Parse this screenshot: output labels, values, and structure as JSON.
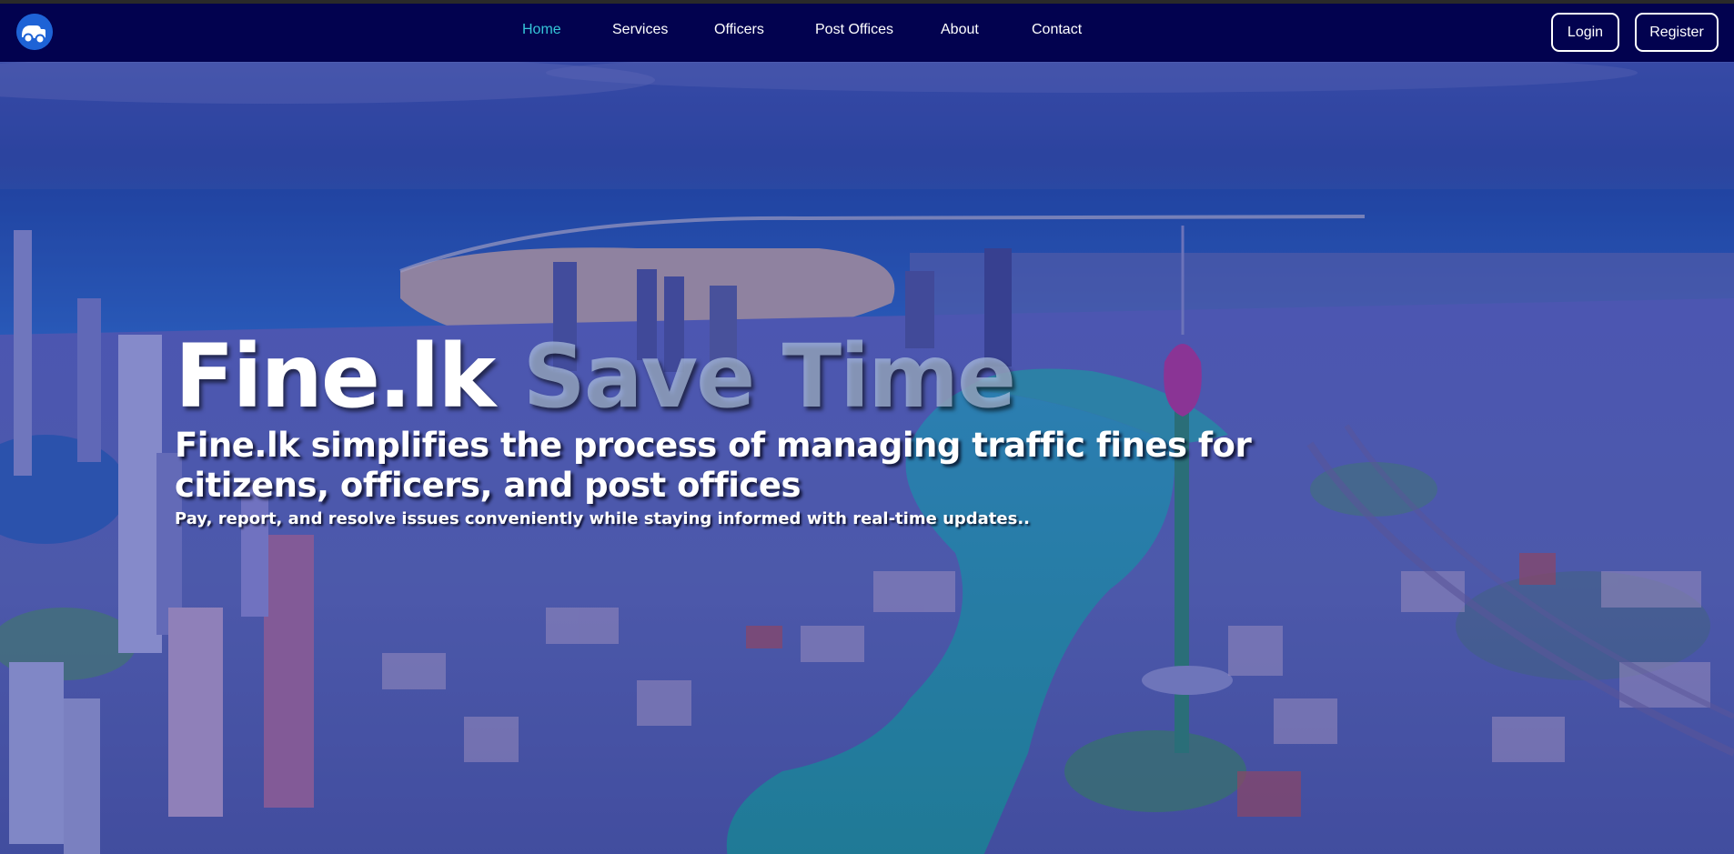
{
  "navbar": {
    "logo_icon": "car-icon",
    "links": [
      {
        "label": "Home",
        "active": true
      },
      {
        "label": "Services",
        "active": false
      },
      {
        "label": "Officers",
        "active": false
      },
      {
        "label": "Post Offices",
        "active": false
      },
      {
        "label": "About",
        "active": false
      },
      {
        "label": "Contact",
        "active": false
      }
    ],
    "login_label": "Login",
    "register_label": "Register"
  },
  "hero": {
    "title_brand": "Fine.lk",
    "title_accent": "Save Time",
    "subtitle": "Fine.lk simplifies the process of managing traffic fines for citizens, officers, and post offices",
    "description": "Pay, report, and resolve issues conveniently while staying informed with real-time updates.."
  },
  "colors": {
    "navbar_bg": "#02024f",
    "active_link": "#35c5d8",
    "text": "#ffffff",
    "overlay": "#2828a0"
  }
}
